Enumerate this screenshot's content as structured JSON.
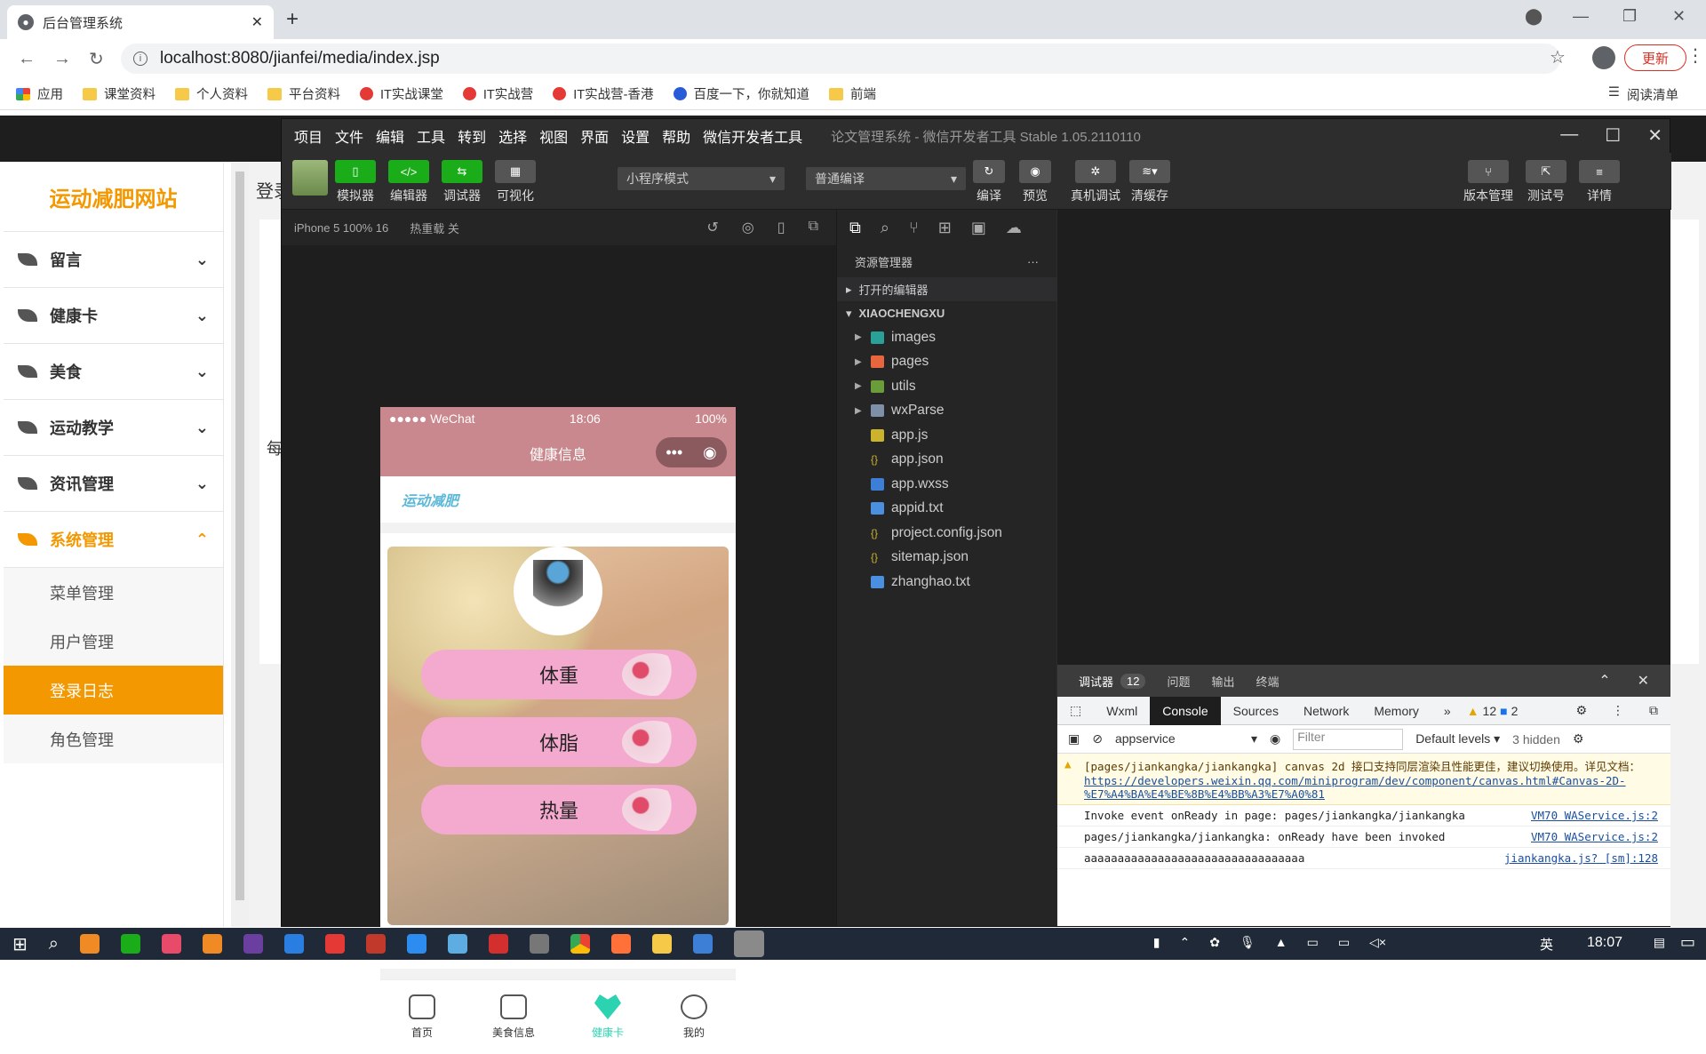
{
  "browser": {
    "tab_title": "后台管理系统",
    "url": "localhost:8080/jianfei/media/index.jsp",
    "update_label": "更新",
    "bookmarks": [
      "应用",
      "课堂资料",
      "个人资料",
      "平台资料",
      "IT实战课堂",
      "IT实战营",
      "IT实战营-香港",
      "百度一下，你就知道",
      "前端"
    ],
    "reading_list": "阅读清单"
  },
  "site": {
    "brand": "运动减肥网站",
    "menus": [
      {
        "label": "留言"
      },
      {
        "label": "健康卡"
      },
      {
        "label": "美食"
      },
      {
        "label": "运动教学"
      },
      {
        "label": "资讯管理"
      },
      {
        "label": "系统管理"
      }
    ],
    "submenus": [
      "菜单管理",
      "用户管理",
      "登录日志",
      "角色管理"
    ],
    "page_text_1": "登录",
    "page_text_2": "每"
  },
  "ide": {
    "menu": [
      "项目",
      "文件",
      "编辑",
      "工具",
      "转到",
      "选择",
      "视图",
      "界面",
      "设置",
      "帮助",
      "微信开发者工具"
    ],
    "title": "论文管理系统 - 微信开发者工具 Stable 1.05.2110110",
    "tools": [
      "模拟器",
      "编辑器",
      "调试器",
      "可视化"
    ],
    "mode_select": "小程序模式",
    "compile_select": "普通编译",
    "actions": [
      "编译",
      "预览",
      "真机调试",
      "清缓存"
    ],
    "right_actions": [
      "版本管理",
      "测试号",
      "详情"
    ],
    "device": "iPhone 5 100% 16",
    "hotreload": "热重载 关"
  },
  "phone": {
    "carrier": "●●●●● WeChat",
    "time": "18:06",
    "battery": "100%",
    "page_title": "健康信息",
    "logo": "运动减肥",
    "buttons": [
      "体重",
      "体脂",
      "热量"
    ],
    "tabs": [
      "首页",
      "美食信息",
      "健康卡",
      "我的"
    ]
  },
  "explorer": {
    "header": "资源管理器",
    "open_editors": "打开的编辑器",
    "project": "XIAOCHENGXU",
    "folders": [
      "images",
      "pages",
      "utils",
      "wxParse"
    ],
    "files": [
      "app.js",
      "app.json",
      "app.wxss",
      "appid.txt",
      "project.config.json",
      "sitemap.json",
      "zhanghao.txt"
    ]
  },
  "debugger": {
    "tabs": [
      "调试器",
      "问题",
      "输出",
      "终端"
    ],
    "count": "12",
    "panels": [
      "Wxml",
      "Console",
      "Sources",
      "Network",
      "Memory"
    ],
    "warn_count": "12",
    "info_count": "2",
    "context": "appservice",
    "filter_placeholder": "Filter",
    "levels": "Default levels",
    "hidden": "3 hidden",
    "logs": [
      {
        "text": "[pages/jiankangka/jiankangka] canvas 2d 接口支持同层渲染且性能更佳，建议切换使用。详见文档：",
        "link": "https://developers.weixin.qq.com/miniprogram/dev/component/canvas.html#Canvas-2D-%E7%A4%BA%E4%BE%8B%E4%BB%A3%E7%A0%81",
        "src": ""
      },
      {
        "text": "Invoke event onReady in page: pages/jiankangka/jiankangka",
        "link": "",
        "src": "VM70 WAService.js:2"
      },
      {
        "text": "pages/jiankangka/jiankangka: onReady have been invoked",
        "link": "",
        "src": "VM70 WAService.js:2"
      },
      {
        "text": "aaaaaaaaaaaaaaaaaaaaaaaaaaaaaaaaa",
        "link": "",
        "src": "jiankangka.js? [sm]:128"
      }
    ]
  },
  "taskbar": {
    "time": "18:07",
    "ime": "英"
  }
}
